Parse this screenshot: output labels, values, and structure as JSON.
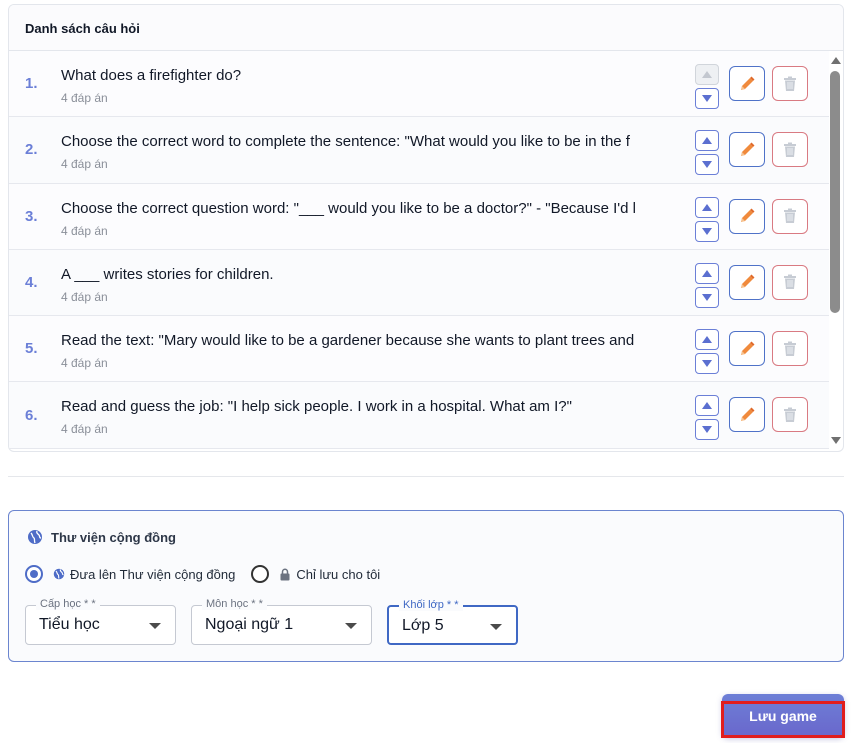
{
  "question_list": {
    "title": "Danh sách câu hỏi",
    "questions": [
      {
        "num": "1.",
        "text": "What does a firefighter do?",
        "answers": "4 đáp án"
      },
      {
        "num": "2.",
        "text": "Choose the correct word to complete the sentence: \"What would you like to be in the f",
        "answers": "4 đáp án"
      },
      {
        "num": "3.",
        "text": "Choose the correct question word: \"___ would you like to be a doctor?\" - \"Because I'd l",
        "answers": "4 đáp án"
      },
      {
        "num": "4.",
        "text": "A ___ writes stories for children.",
        "answers": "4 đáp án"
      },
      {
        "num": "5.",
        "text": "Read the text: \"Mary would like to be a gardener because she wants to plant trees and",
        "answers": "4 đáp án"
      },
      {
        "num": "6.",
        "text": "Read and guess the job: \"I help sick people. I work in a hospital. What am I?\"",
        "answers": "4 đáp án"
      }
    ]
  },
  "library": {
    "title": "Thư viện cộng đồng",
    "option_public": "Đưa lên Thư viện cộng đồng",
    "option_private": "Chỉ lưu cho tôi",
    "selected_option": "public",
    "fields": {
      "level": {
        "label": "Cấp học * *",
        "value": "Tiểu học"
      },
      "subject": {
        "label": "Môn học * *",
        "value": "Ngoại ngữ 1"
      },
      "grade": {
        "label": "Khối lớp * *",
        "value": "Lớp 5"
      }
    }
  },
  "save_label": "Lưu game",
  "colors": {
    "accent": "#6b7fd7",
    "edit_border": "#4f72c8",
    "delete_border": "#d97a82",
    "edit_icon": "#f08a3c",
    "highlight": "#e11d1d"
  },
  "icons": {
    "edit": "pencil-icon",
    "delete": "trash-icon",
    "move_up": "arrow-up-icon",
    "move_down": "arrow-down-icon",
    "globe": "globe-icon",
    "lock": "lock-icon"
  }
}
